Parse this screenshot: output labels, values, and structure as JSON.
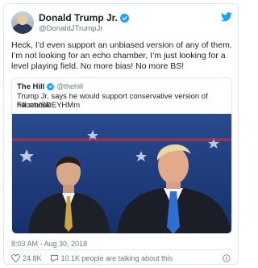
{
  "tweet": {
    "display_name": "Donald Trump Jr.",
    "handle": "@DonaldJTrumpJr",
    "text": "Heck, I’d even support an unbiased version of any of them. I’m not looking for an echo chamber, I’m just looking for a level playing field. No more bias! No more BS!",
    "timestamp": "8:03 AM - Aug 30, 2018",
    "likes": "24.8K",
    "replies_text": "10.1K people are talking about this"
  },
  "quoted": {
    "source": "The Hill",
    "handle": "@thehill",
    "text": "Trump Jr. says he would support conservative version of Facebook",
    "link": "hill.cm/SDEYHMm"
  },
  "icons": {
    "verified": "verified-badge-icon",
    "twitter": "twitter-bird-icon",
    "heart": "heart-icon",
    "reply": "speech-bubble-icon",
    "info": "info-icon"
  },
  "colors": {
    "accent": "#1da1f2",
    "text": "#1c2022",
    "muted": "#697882",
    "border": "#e1e8ed"
  }
}
